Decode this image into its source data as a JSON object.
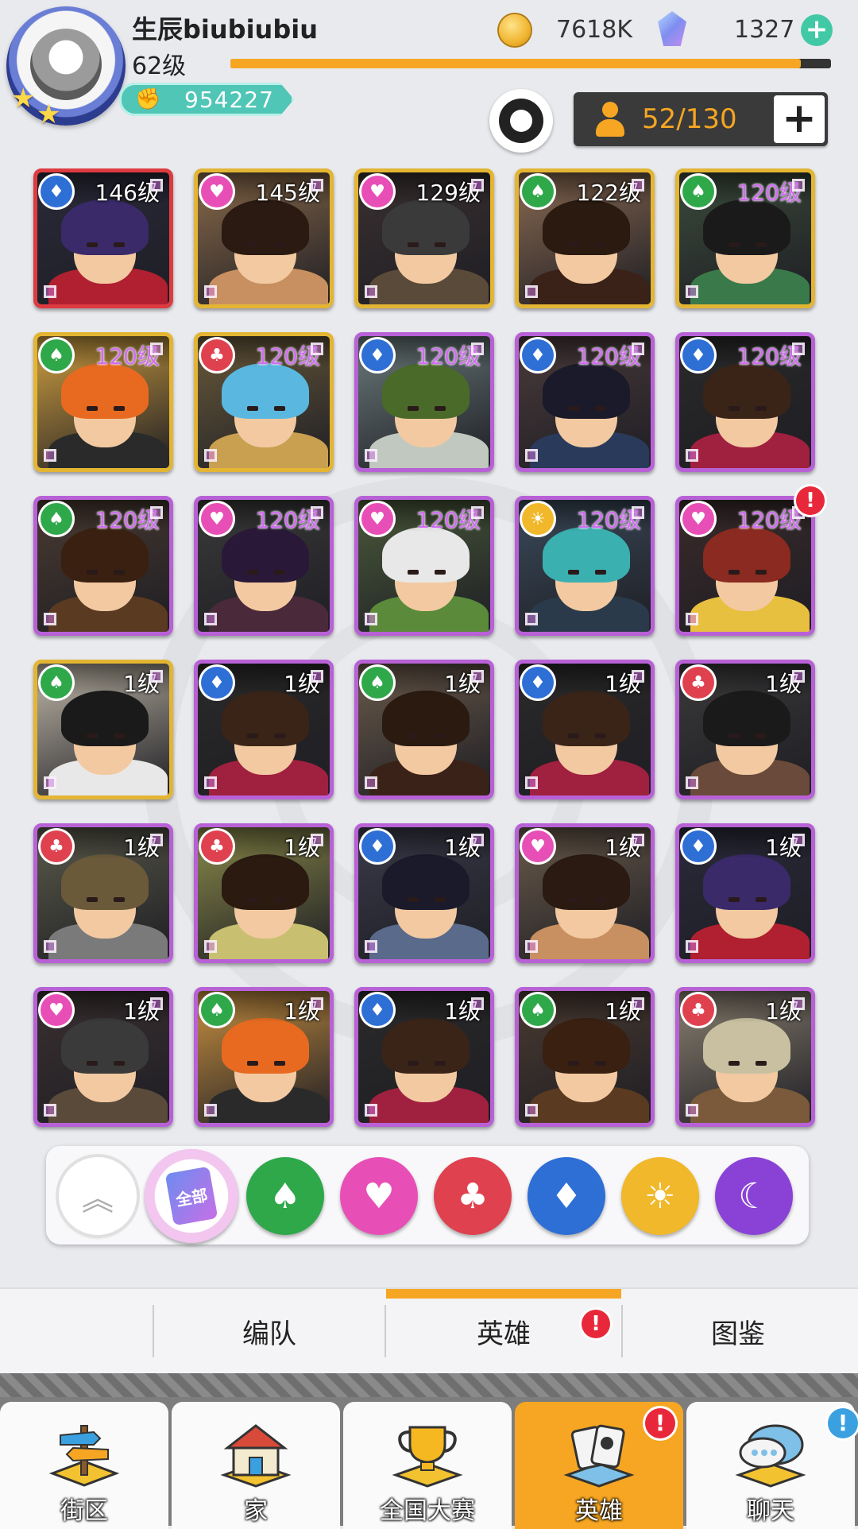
{
  "header": {
    "player_name": "生辰biubiubiu",
    "level": "62级",
    "power": "954227",
    "xp_fraction": 0.95,
    "coins": "7618K",
    "gems": "1327",
    "capacity": "52/130"
  },
  "heroes": [
    {
      "level": "146级",
      "faction": "blue",
      "rank": "red",
      "hair": "#3a2a6a",
      "outfit": "#b02030",
      "bg": "#2a2a3a"
    },
    {
      "level": "145级",
      "faction": "pink",
      "rank": "gold",
      "hair": "#2a1a12",
      "outfit": "#c89060",
      "bg": "#8a6a4a"
    },
    {
      "level": "129级",
      "faction": "pink",
      "rank": "gold",
      "hair": "#3a3a3a",
      "outfit": "#5a4a3a",
      "bg": "#3a3030"
    },
    {
      "level": "122级",
      "faction": "green",
      "rank": "gold",
      "hair": "#2a1a10",
      "outfit": "#3a2218",
      "bg": "#8a6a52"
    },
    {
      "level": "120级",
      "faction": "green",
      "rank": "gold",
      "hair": "#1a1a1a",
      "outfit": "#3a7a4a",
      "bg": "#3a4a3a"
    },
    {
      "level": "120级",
      "faction": "green",
      "rank": "gold",
      "hair": "#e86a20",
      "outfit": "#2a2a2a",
      "bg": "#d0a040"
    },
    {
      "level": "120级",
      "faction": "red",
      "rank": "gold",
      "hair": "#5ab8e0",
      "outfit": "#c8a050",
      "bg": "#6a5a3a"
    },
    {
      "level": "120级",
      "faction": "blue",
      "rank": "purple",
      "hair": "#4a6a2a",
      "outfit": "#c0c8c0",
      "bg": "#6a7a7a"
    },
    {
      "level": "120级",
      "faction": "blue",
      "rank": "purple",
      "hair": "#1a1a2a",
      "outfit": "#2a3a5a",
      "bg": "#4a3a3a"
    },
    {
      "level": "120级",
      "faction": "blue",
      "rank": "purple",
      "hair": "#3a2418",
      "outfit": "#a02040",
      "bg": "#2a2a2a"
    },
    {
      "level": "120级",
      "faction": "green",
      "rank": "purple",
      "hair": "#3a2010",
      "outfit": "#5a3a20",
      "bg": "#4a3a30"
    },
    {
      "level": "120级",
      "faction": "pink",
      "rank": "purple",
      "hair": "#2a1838",
      "outfit": "#4a2a3a",
      "bg": "#3a3a3a"
    },
    {
      "level": "120级",
      "faction": "pink",
      "rank": "purple",
      "hair": "#e8e8e8",
      "outfit": "#5a8a3a",
      "bg": "#4a5a3a"
    },
    {
      "level": "120级",
      "faction": "gold",
      "rank": "purple",
      "hair": "#3ab0b0",
      "outfit": "#2a3a4a",
      "bg": "#3a4a5a"
    },
    {
      "level": "120级",
      "faction": "pink",
      "rank": "purple",
      "hair": "#8a2a20",
      "outfit": "#e8c040",
      "bg": "#3a2a2a",
      "alert": "!"
    },
    {
      "level": "1级",
      "faction": "green",
      "rank": "gold",
      "hair": "#1a1a1a",
      "outfit": "#e8e8e8",
      "bg": "#c0b8a8"
    },
    {
      "level": "1级",
      "faction": "blue",
      "rank": "purple",
      "hair": "#3a2418",
      "outfit": "#a02040",
      "bg": "#2a2a2a"
    },
    {
      "level": "1级",
      "faction": "green",
      "rank": "purple",
      "hair": "#2a1a10",
      "outfit": "#3a2218",
      "bg": "#6a5a4a"
    },
    {
      "level": "1级",
      "faction": "blue",
      "rank": "purple",
      "hair": "#3a2418",
      "outfit": "#a02040",
      "bg": "#2a2a2a"
    },
    {
      "level": "1级",
      "faction": "red",
      "rank": "purple",
      "hair": "#1a1a1a",
      "outfit": "#6a4a3a",
      "bg": "#3a3a3a"
    },
    {
      "level": "1级",
      "faction": "red",
      "rank": "purple",
      "hair": "#6a5a3a",
      "outfit": "#7a7a7a",
      "bg": "#5a5a4a"
    },
    {
      "level": "1级",
      "faction": "red",
      "rank": "purple",
      "hair": "#2a1a10",
      "outfit": "#c8c070",
      "bg": "#8a8a4a"
    },
    {
      "level": "1级",
      "faction": "blue",
      "rank": "purple",
      "hair": "#1a1a2a",
      "outfit": "#5a6a8a",
      "bg": "#3a3a4a"
    },
    {
      "level": "1级",
      "faction": "pink",
      "rank": "purple",
      "hair": "#2a1a12",
      "outfit": "#c89060",
      "bg": "#6a5a4a"
    },
    {
      "level": "1级",
      "faction": "blue",
      "rank": "purple",
      "hair": "#3a2a6a",
      "outfit": "#b02030",
      "bg": "#2a2a3a"
    },
    {
      "level": "1级",
      "faction": "pink",
      "rank": "purple",
      "hair": "#3a3a3a",
      "outfit": "#5a4a3a",
      "bg": "#3a3030"
    },
    {
      "level": "1级",
      "faction": "green",
      "rank": "purple",
      "hair": "#e86a20",
      "outfit": "#2a2a2a",
      "bg": "#c89040"
    },
    {
      "level": "1级",
      "faction": "blue",
      "rank": "purple",
      "hair": "#3a2418",
      "outfit": "#a02040",
      "bg": "#2a2a2a"
    },
    {
      "level": "1级",
      "faction": "green",
      "rank": "purple",
      "hair": "#3a2010",
      "outfit": "#5a3a20",
      "bg": "#4a3a30"
    },
    {
      "level": "1级",
      "faction": "red",
      "rank": "purple",
      "hair": "#c8c0a0",
      "outfit": "#7a5a3a",
      "bg": "#8a8070"
    }
  ],
  "filters": {
    "all_label": "全部",
    "items": [
      {
        "name": "collapse",
        "icon": "chevron-up-icon"
      },
      {
        "name": "all",
        "icon": "cards-icon"
      },
      {
        "name": "spade",
        "icon": "spade-icon",
        "color": "#2fa84a"
      },
      {
        "name": "heart",
        "icon": "heart-icon",
        "color": "#e84fb6"
      },
      {
        "name": "club",
        "icon": "club-icon",
        "color": "#e0414f"
      },
      {
        "name": "diamond",
        "icon": "diamond-icon",
        "color": "#2e6fd6"
      },
      {
        "name": "sun",
        "icon": "sun-icon",
        "color": "#f0b82a"
      },
      {
        "name": "moon",
        "icon": "moon-icon",
        "color": "#8a42d6"
      }
    ]
  },
  "tabs": {
    "formation": "编队",
    "heroes": "英雄",
    "codex": "图鉴",
    "heroes_alert": "!"
  },
  "nav": {
    "district": "街区",
    "home": "家",
    "contest": "全国大赛",
    "heroes": "英雄",
    "chat": "聊天",
    "heroes_alert": "!",
    "chat_alert": "!"
  },
  "colors": {
    "accent": "#f6a623",
    "alert": "#e8283a",
    "power": "#4fc6b6"
  }
}
